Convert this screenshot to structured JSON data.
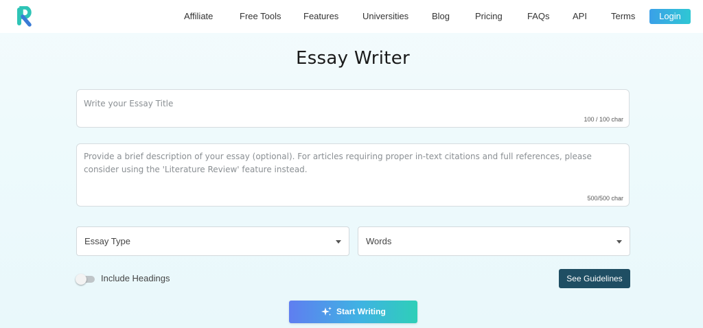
{
  "nav": {
    "items": [
      "Affiliate",
      "Free Tools",
      "Features",
      "Universities",
      "Blog",
      "Pricing",
      "FAQs",
      "API",
      "Terms"
    ],
    "login_label": "Login"
  },
  "page_title": "Essay Writer",
  "title_field": {
    "placeholder": "Write your Essay Title",
    "char_count": "100 / 100 char"
  },
  "description_field": {
    "placeholder": "Provide a brief description of your essay (optional). For articles requiring proper in-text citations and full references, please consider using the 'Literature Review' feature instead.",
    "char_count": "500/500 char"
  },
  "essay_type_select": {
    "label": "Essay Type"
  },
  "words_select": {
    "label": "Words"
  },
  "include_headings": {
    "label": "Include Headings",
    "enabled": false
  },
  "see_guidelines_label": "See Guidelines",
  "start_writing_label": "Start Writing",
  "colors": {
    "accent_login": "#3aa0e8",
    "guidelines_bg": "#1f4e63",
    "start_gradient_start": "#5f7ef0",
    "start_gradient_end": "#2ecfb8",
    "logo_teal": "#2ec4b6",
    "logo_blue": "#3a7bd5"
  }
}
